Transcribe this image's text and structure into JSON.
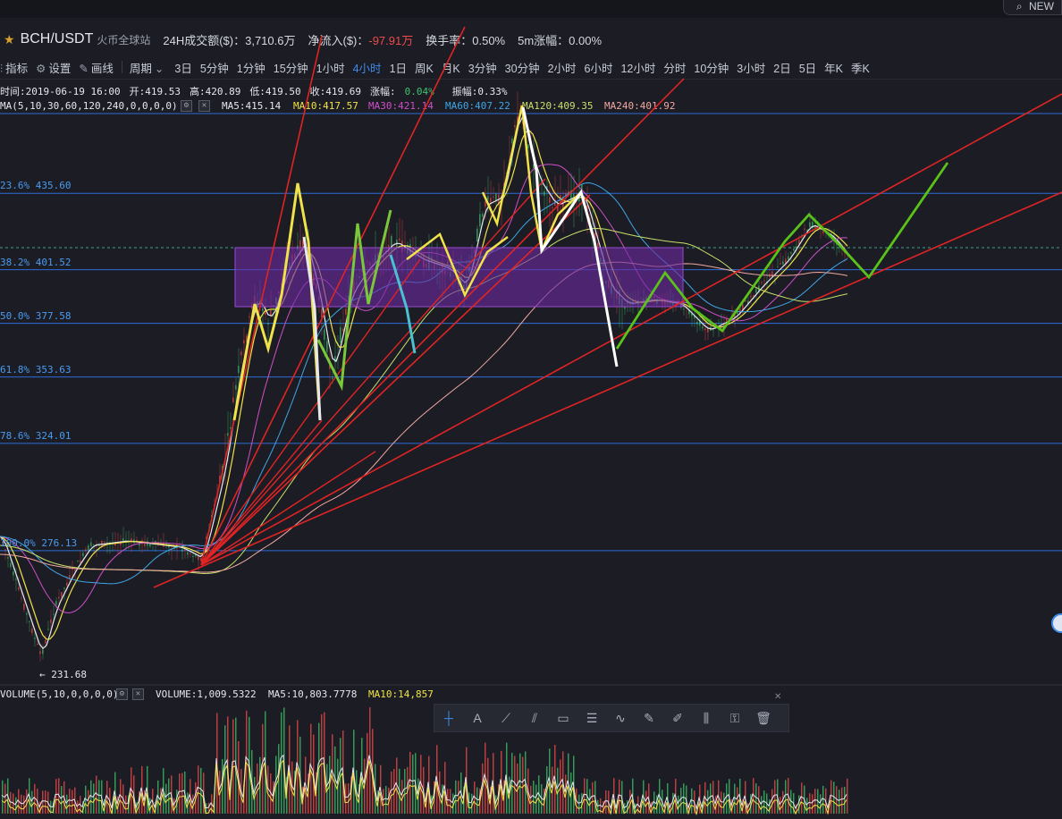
{
  "topbar": {
    "new_label": "NEW",
    "search_icon": "search-icon"
  },
  "pair": {
    "name": "BCH/USDT",
    "exchange": "火币全球站"
  },
  "stats": {
    "volume_24h": "24H成交额($)：3,710.6万",
    "net_inflow_label": "净流入($)：",
    "net_inflow_value": "-97.91万",
    "turnover": "换手率：0.50%",
    "change_5m": "5m涨幅：0.00%"
  },
  "toolbar": {
    "indicators": "指标",
    "settings": "设置",
    "draw": "画线",
    "period": "周期",
    "intervals": [
      "3日",
      "5分钟",
      "1分钟",
      "15分钟",
      "1小时",
      "4小时",
      "1日",
      "周K",
      "月K",
      "3分钟",
      "30分钟",
      "2小时",
      "6小时",
      "12小时",
      "分时",
      "10分钟",
      "3小时",
      "2日",
      "5日",
      "年K",
      "季K"
    ],
    "active_interval": "4小时"
  },
  "ohlc": {
    "time": "时间:2019-06-19 16:00",
    "open": "开:419.53",
    "high": "高:420.89",
    "low": "低:419.50",
    "close": "收:419.69",
    "change_label": "涨幅:",
    "change_value": "0.04%",
    "amplitude": "振幅:0.33%"
  },
  "ma": {
    "params": "MA(5,10,30,60,120,240,0,0,0,0)",
    "ma5": "MA5:415.14",
    "ma10": "MA10:417.57",
    "ma30": "MA30:421.14",
    "ma60": "MA60:407.22",
    "ma120": "MA120:409.35",
    "ma240": "MA240:401.92"
  },
  "fib_levels": [
    {
      "label": "23.6% 435.60",
      "price": 435.6
    },
    {
      "label": "38.2% 401.52",
      "price": 401.52
    },
    {
      "label": "50.0% 377.58",
      "price": 377.58
    },
    {
      "label": "61.8% 353.63",
      "price": 353.63
    },
    {
      "label": "78.6% 324.01",
      "price": 324.01
    },
    {
      "label": "100.0% 276.13",
      "price": 276.13
    }
  ],
  "low_marker": "← 231.68",
  "volume": {
    "params": "VOLUME(5,10,0,0,0,0)",
    "value": "VOLUME:1,009.5322",
    "ma5": "MA5:10,803.7778",
    "ma10": "MA10:14,857"
  },
  "draw_tools": [
    "crosshair-icon",
    "text-icon",
    "line-icon",
    "channel-icon",
    "rectangle-icon",
    "fib-icon",
    "wave-icon",
    "ruler-icon",
    "brush-icon",
    "pattern-icon",
    "lock-icon",
    "trash-icon"
  ],
  "colors": {
    "ma5": "#e6e8ee",
    "ma10": "#f0e24a",
    "ma30": "#d04fc8",
    "ma60": "#3fa6e6",
    "ma120": "#c8e06a",
    "ma240": "#f0a8a0",
    "up": "#3fc36b",
    "down": "#ef4b4b",
    "accent": "#3e8bea"
  }
}
